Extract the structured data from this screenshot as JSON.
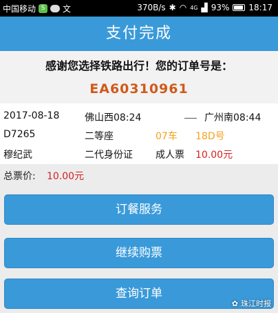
{
  "statusbar": {
    "carrier": "中国移动",
    "badge": "S",
    "extra_glyph": "文",
    "net_speed": "370B/s",
    "network": "4G",
    "battery": "93%",
    "time": "18:17"
  },
  "header": {
    "title": "支付完成"
  },
  "thanks": {
    "message": "感谢您选择铁路出行！您的订单号是：",
    "order_number": "EA60310961"
  },
  "ticket": {
    "date": "2017-08-18",
    "from": "佛山西08:24",
    "to": "广州南08:44",
    "train": "D7265",
    "seat_class": "二等座",
    "car": "07车",
    "seat": "18D号",
    "passenger": "穆纪武",
    "id_type": "二代身份证",
    "ticket_type": "成人票",
    "price": "10.00元"
  },
  "total": {
    "label": "总票价:",
    "value": "10.00元"
  },
  "buttons": {
    "order_meal": "订餐服务",
    "buy_more": "继续购票",
    "query_order": "查询订单"
  },
  "watermark": {
    "text": "珠江时报"
  },
  "colors": {
    "header_blue": "#3a9ad9",
    "order_orange": "#d05a1a",
    "seat_yellow": "#f3a21b",
    "price_red": "#d42121"
  }
}
